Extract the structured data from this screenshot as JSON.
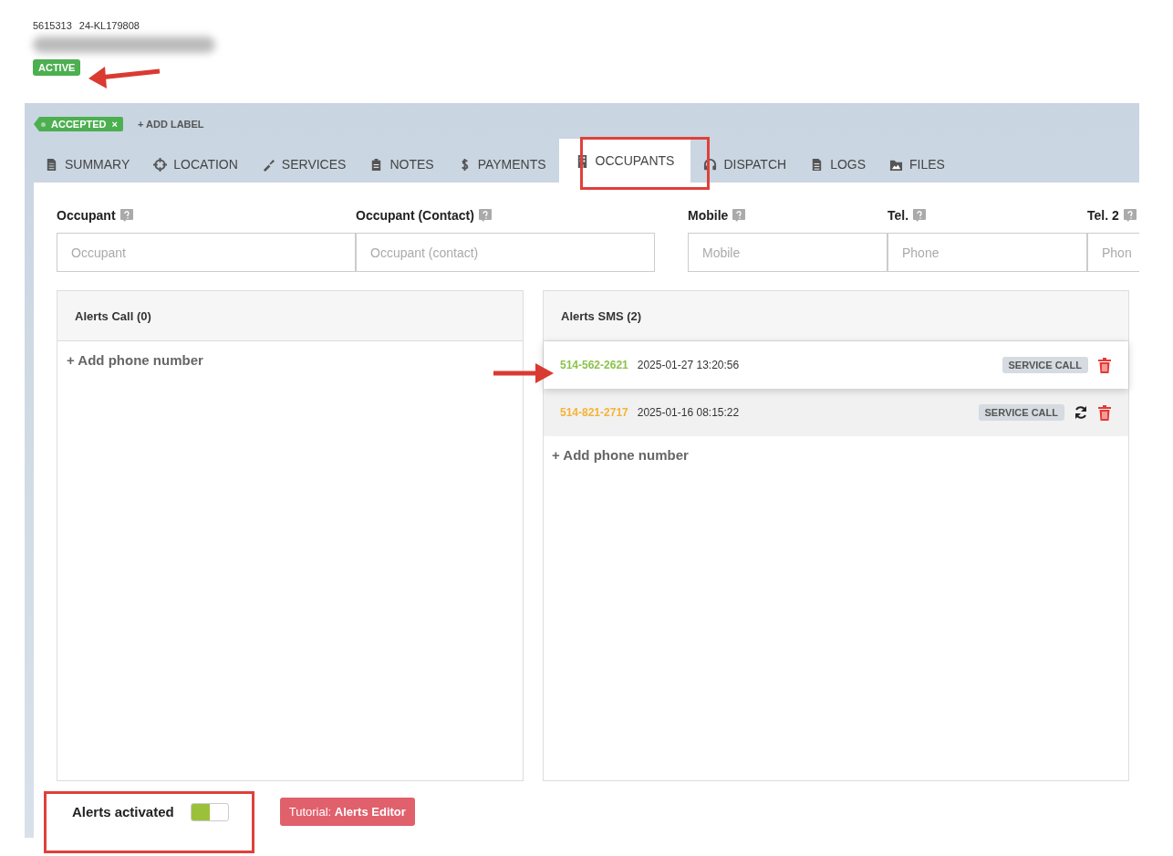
{
  "header": {
    "id": "5615313",
    "reference": "24-KL179808",
    "status": "ACTIVE"
  },
  "labels": [
    {
      "text": "ACCEPTED",
      "remove": "×"
    }
  ],
  "add_label": "+ ADD LABEL",
  "tabs": [
    {
      "label": "SUMMARY",
      "selected": false
    },
    {
      "label": "LOCATION",
      "selected": false
    },
    {
      "label": "SERVICES",
      "selected": false
    },
    {
      "label": "NOTES",
      "selected": false
    },
    {
      "label": "PAYMENTS",
      "selected": false
    },
    {
      "label": "OCCUPANTS",
      "selected": true
    },
    {
      "label": "DISPATCH",
      "selected": false
    },
    {
      "label": "LOGS",
      "selected": false
    },
    {
      "label": "FILES",
      "selected": false
    }
  ],
  "fields_left": [
    {
      "label": "Occupant",
      "placeholder": "Occupant"
    },
    {
      "label": "Occupant (Contact)",
      "placeholder": "Occupant (contact)"
    }
  ],
  "fields_right": [
    {
      "label": "Mobile",
      "placeholder": "Mobile"
    },
    {
      "label": "Tel.",
      "placeholder": "Phone"
    },
    {
      "label": "Tel. 2",
      "placeholder": "Phon"
    }
  ],
  "alerts_call": {
    "title": "Alerts Call (0)",
    "add": "+ Add phone number"
  },
  "alerts_sms": {
    "title": "Alerts SMS (2)",
    "items": [
      {
        "number": "514-562-2621",
        "color": "#8bc34a",
        "datetime": "2025-01-27 13:20:56",
        "tag": "SERVICE CALL",
        "resend": false,
        "selected": true
      },
      {
        "number": "514-821-2717",
        "color": "#f5b335",
        "datetime": "2025-01-16 08:15:22",
        "tag": "SERVICE CALL",
        "resend": true,
        "selected": false
      }
    ],
    "add": "+ Add phone number"
  },
  "alerts_toggle": {
    "label": "Alerts activated",
    "on": true
  },
  "tutorial": {
    "prefix": "Tutorial: ",
    "name": "Alerts Editor"
  }
}
